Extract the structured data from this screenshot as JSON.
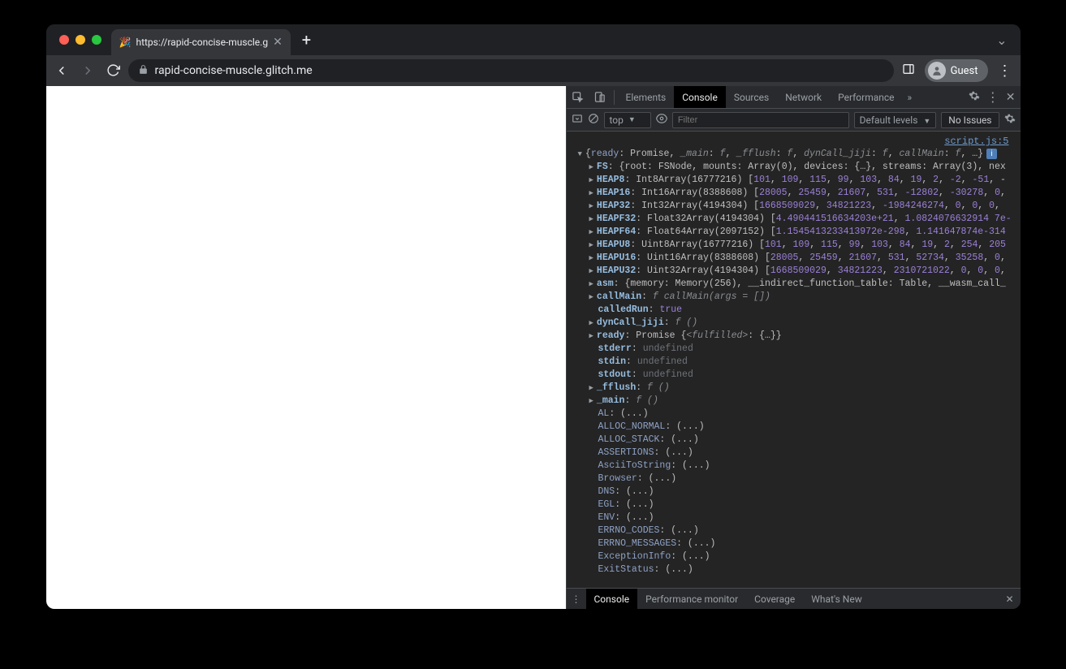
{
  "browser": {
    "tab_title": "https://rapid-concise-muscle.g",
    "tab_favicon": "🎉",
    "url_display": "rapid-concise-muscle.glitch.me",
    "guest_label": "Guest"
  },
  "devtools": {
    "tabs": [
      "Elements",
      "Console",
      "Sources",
      "Network",
      "Performance"
    ],
    "active_tab": "Console",
    "overflow_label": "»",
    "console_toolbar": {
      "context_label": "top",
      "filter_placeholder": "Filter",
      "levels_label": "Default levels",
      "no_issues_label": "No Issues"
    },
    "source_link": "script.js:5",
    "drawer_tabs": [
      "Console",
      "Performance monitor",
      "Coverage",
      "What's New"
    ],
    "active_drawer_tab": "Console"
  },
  "console_output": {
    "summary": {
      "parts": [
        {
          "t": "key",
          "v": "ready"
        },
        {
          "t": "p",
          "v": ": Promise, "
        },
        {
          "t": "ital",
          "v": "_main"
        },
        {
          "t": "p",
          "v": ": "
        },
        {
          "t": "ital",
          "v": "f"
        },
        {
          "t": "p",
          "v": ", "
        },
        {
          "t": "ital",
          "v": "_fflush"
        },
        {
          "t": "p",
          "v": ": "
        },
        {
          "t": "ital",
          "v": "f"
        },
        {
          "t": "p",
          "v": ", "
        },
        {
          "t": "ital",
          "v": "dynCall_jiji"
        },
        {
          "t": "p",
          "v": ": "
        },
        {
          "t": "ital",
          "v": "f"
        },
        {
          "t": "p",
          "v": ", "
        },
        {
          "t": "ital",
          "v": "callMain"
        },
        {
          "t": "p",
          "v": ": "
        },
        {
          "t": "ital",
          "v": "f"
        },
        {
          "t": "p",
          "v": ", …}"
        }
      ]
    },
    "lines": [
      {
        "arrow": true,
        "parts": [
          {
            "t": "keyb",
            "v": "FS"
          },
          {
            "t": "p",
            "v": ": {root: "
          },
          {
            "t": "str",
            "v": "FSNode"
          },
          {
            "t": "p",
            "v": ", mounts: Array(0), devices: {…}, streams: Array(3), nex"
          }
        ]
      },
      {
        "arrow": true,
        "parts": [
          {
            "t": "keyb",
            "v": "HEAP8"
          },
          {
            "t": "p",
            "v": ": Int8Array(16777216) ["
          },
          {
            "t": "num",
            "v": "101"
          },
          {
            "t": "p",
            "v": ", "
          },
          {
            "t": "num",
            "v": "109"
          },
          {
            "t": "p",
            "v": ", "
          },
          {
            "t": "num",
            "v": "115"
          },
          {
            "t": "p",
            "v": ", "
          },
          {
            "t": "num",
            "v": "99"
          },
          {
            "t": "p",
            "v": ", "
          },
          {
            "t": "num",
            "v": "103"
          },
          {
            "t": "p",
            "v": ", "
          },
          {
            "t": "num",
            "v": "84"
          },
          {
            "t": "p",
            "v": ", "
          },
          {
            "t": "num",
            "v": "19"
          },
          {
            "t": "p",
            "v": ", "
          },
          {
            "t": "num",
            "v": "2"
          },
          {
            "t": "p",
            "v": ", "
          },
          {
            "t": "num",
            "v": "-2"
          },
          {
            "t": "p",
            "v": ", "
          },
          {
            "t": "num",
            "v": "-51"
          },
          {
            "t": "p",
            "v": ", -"
          }
        ]
      },
      {
        "arrow": true,
        "parts": [
          {
            "t": "keyb",
            "v": "HEAP16"
          },
          {
            "t": "p",
            "v": ": Int16Array(8388608) ["
          },
          {
            "t": "num",
            "v": "28005"
          },
          {
            "t": "p",
            "v": ", "
          },
          {
            "t": "num",
            "v": "25459"
          },
          {
            "t": "p",
            "v": ", "
          },
          {
            "t": "num",
            "v": "21607"
          },
          {
            "t": "p",
            "v": ", "
          },
          {
            "t": "num",
            "v": "531"
          },
          {
            "t": "p",
            "v": ", "
          },
          {
            "t": "num",
            "v": "-12802"
          },
          {
            "t": "p",
            "v": ", "
          },
          {
            "t": "num",
            "v": "-30278"
          },
          {
            "t": "p",
            "v": ", "
          },
          {
            "t": "num",
            "v": "0"
          },
          {
            "t": "p",
            "v": ","
          }
        ]
      },
      {
        "arrow": true,
        "parts": [
          {
            "t": "keyb",
            "v": "HEAP32"
          },
          {
            "t": "p",
            "v": ": Int32Array(4194304) ["
          },
          {
            "t": "num",
            "v": "1668509029"
          },
          {
            "t": "p",
            "v": ", "
          },
          {
            "t": "num",
            "v": "34821223"
          },
          {
            "t": "p",
            "v": ", "
          },
          {
            "t": "num",
            "v": "-1984246274"
          },
          {
            "t": "p",
            "v": ", "
          },
          {
            "t": "num",
            "v": "0"
          },
          {
            "t": "p",
            "v": ", "
          },
          {
            "t": "num",
            "v": "0"
          },
          {
            "t": "p",
            "v": ", "
          },
          {
            "t": "num",
            "v": "0"
          },
          {
            "t": "p",
            "v": ", "
          }
        ]
      },
      {
        "arrow": true,
        "parts": [
          {
            "t": "keyb",
            "v": "HEAPF32"
          },
          {
            "t": "p",
            "v": ": Float32Array(4194304) ["
          },
          {
            "t": "num",
            "v": "4.490441516634203e+21"
          },
          {
            "t": "p",
            "v": ", "
          },
          {
            "t": "num",
            "v": "1.0824076632914 7e-"
          }
        ]
      },
      {
        "arrow": true,
        "parts": [
          {
            "t": "keyb",
            "v": "HEAPF64"
          },
          {
            "t": "p",
            "v": ": Float64Array(2097152) ["
          },
          {
            "t": "num",
            "v": "1.1545413233413972e-298"
          },
          {
            "t": "p",
            "v": ", "
          },
          {
            "t": "num",
            "v": "1.141647874e-314"
          }
        ]
      },
      {
        "arrow": true,
        "parts": [
          {
            "t": "keyb",
            "v": "HEAPU8"
          },
          {
            "t": "p",
            "v": ": Uint8Array(16777216) ["
          },
          {
            "t": "num",
            "v": "101"
          },
          {
            "t": "p",
            "v": ", "
          },
          {
            "t": "num",
            "v": "109"
          },
          {
            "t": "p",
            "v": ", "
          },
          {
            "t": "num",
            "v": "115"
          },
          {
            "t": "p",
            "v": ", "
          },
          {
            "t": "num",
            "v": "99"
          },
          {
            "t": "p",
            "v": ", "
          },
          {
            "t": "num",
            "v": "103"
          },
          {
            "t": "p",
            "v": ", "
          },
          {
            "t": "num",
            "v": "84"
          },
          {
            "t": "p",
            "v": ", "
          },
          {
            "t": "num",
            "v": "19"
          },
          {
            "t": "p",
            "v": ", "
          },
          {
            "t": "num",
            "v": "2"
          },
          {
            "t": "p",
            "v": ", "
          },
          {
            "t": "num",
            "v": "254"
          },
          {
            "t": "p",
            "v": ", "
          },
          {
            "t": "num",
            "v": "205"
          }
        ]
      },
      {
        "arrow": true,
        "parts": [
          {
            "t": "keyb",
            "v": "HEAPU16"
          },
          {
            "t": "p",
            "v": ": Uint16Array(8388608) ["
          },
          {
            "t": "num",
            "v": "28005"
          },
          {
            "t": "p",
            "v": ", "
          },
          {
            "t": "num",
            "v": "25459"
          },
          {
            "t": "p",
            "v": ", "
          },
          {
            "t": "num",
            "v": "21607"
          },
          {
            "t": "p",
            "v": ", "
          },
          {
            "t": "num",
            "v": "531"
          },
          {
            "t": "p",
            "v": ", "
          },
          {
            "t": "num",
            "v": "52734"
          },
          {
            "t": "p",
            "v": ", "
          },
          {
            "t": "num",
            "v": "35258"
          },
          {
            "t": "p",
            "v": ", "
          },
          {
            "t": "num",
            "v": "0"
          },
          {
            "t": "p",
            "v": ","
          }
        ]
      },
      {
        "arrow": true,
        "parts": [
          {
            "t": "keyb",
            "v": "HEAPU32"
          },
          {
            "t": "p",
            "v": ": Uint32Array(4194304) ["
          },
          {
            "t": "num",
            "v": "1668509029"
          },
          {
            "t": "p",
            "v": ", "
          },
          {
            "t": "num",
            "v": "34821223"
          },
          {
            "t": "p",
            "v": ", "
          },
          {
            "t": "num",
            "v": "2310721022"
          },
          {
            "t": "p",
            "v": ", "
          },
          {
            "t": "num",
            "v": "0"
          },
          {
            "t": "p",
            "v": ", "
          },
          {
            "t": "num",
            "v": "0"
          },
          {
            "t": "p",
            "v": ", "
          },
          {
            "t": "num",
            "v": "0"
          },
          {
            "t": "p",
            "v": ","
          }
        ]
      },
      {
        "arrow": true,
        "parts": [
          {
            "t": "keyb",
            "v": "asm"
          },
          {
            "t": "p",
            "v": ": {memory: Memory(256), __indirect_function_table: Table, __wasm_call_"
          }
        ]
      },
      {
        "arrow": true,
        "parts": [
          {
            "t": "keyb",
            "v": "callMain"
          },
          {
            "t": "p",
            "v": ": "
          },
          {
            "t": "ital",
            "v": "f callMain(args = [])"
          }
        ]
      },
      {
        "arrow": false,
        "parts": [
          {
            "t": "keyb",
            "v": "calledRun"
          },
          {
            "t": "p",
            "v": ": "
          },
          {
            "t": "bool",
            "v": "true"
          }
        ]
      },
      {
        "arrow": true,
        "parts": [
          {
            "t": "keyb",
            "v": "dynCall_jiji"
          },
          {
            "t": "p",
            "v": ": "
          },
          {
            "t": "ital",
            "v": "f ()"
          }
        ]
      },
      {
        "arrow": true,
        "parts": [
          {
            "t": "keyb",
            "v": "ready"
          },
          {
            "t": "p",
            "v": ": Promise {"
          },
          {
            "t": "ital",
            "v": "<fulfilled>"
          },
          {
            "t": "p",
            "v": ": {…}}"
          }
        ]
      },
      {
        "arrow": false,
        "parts": [
          {
            "t": "keyb",
            "v": "stderr"
          },
          {
            "t": "p",
            "v": ": "
          },
          {
            "t": "undef",
            "v": "undefined"
          }
        ]
      },
      {
        "arrow": false,
        "parts": [
          {
            "t": "keyb",
            "v": "stdin"
          },
          {
            "t": "p",
            "v": ": "
          },
          {
            "t": "undef",
            "v": "undefined"
          }
        ]
      },
      {
        "arrow": false,
        "parts": [
          {
            "t": "keyb",
            "v": "stdout"
          },
          {
            "t": "p",
            "v": ": "
          },
          {
            "t": "undef",
            "v": "undefined"
          }
        ]
      },
      {
        "arrow": true,
        "parts": [
          {
            "t": "keyb",
            "v": "_fflush"
          },
          {
            "t": "p",
            "v": ": "
          },
          {
            "t": "ital",
            "v": "f ()"
          }
        ]
      },
      {
        "arrow": true,
        "parts": [
          {
            "t": "keyb",
            "v": "_main"
          },
          {
            "t": "p",
            "v": ": "
          },
          {
            "t": "ital",
            "v": "f ()"
          }
        ]
      },
      {
        "arrow": false,
        "parts": [
          {
            "t": "key",
            "v": "AL"
          },
          {
            "t": "p",
            "v": ": (...)"
          }
        ]
      },
      {
        "arrow": false,
        "parts": [
          {
            "t": "key",
            "v": "ALLOC_NORMAL"
          },
          {
            "t": "p",
            "v": ": (...)"
          }
        ]
      },
      {
        "arrow": false,
        "parts": [
          {
            "t": "key",
            "v": "ALLOC_STACK"
          },
          {
            "t": "p",
            "v": ": (...)"
          }
        ]
      },
      {
        "arrow": false,
        "parts": [
          {
            "t": "key",
            "v": "ASSERTIONS"
          },
          {
            "t": "p",
            "v": ": (...)"
          }
        ]
      },
      {
        "arrow": false,
        "parts": [
          {
            "t": "key",
            "v": "AsciiToString"
          },
          {
            "t": "p",
            "v": ": (...)"
          }
        ]
      },
      {
        "arrow": false,
        "parts": [
          {
            "t": "key",
            "v": "Browser"
          },
          {
            "t": "p",
            "v": ": (...)"
          }
        ]
      },
      {
        "arrow": false,
        "parts": [
          {
            "t": "key",
            "v": "DNS"
          },
          {
            "t": "p",
            "v": ": (...)"
          }
        ]
      },
      {
        "arrow": false,
        "parts": [
          {
            "t": "key",
            "v": "EGL"
          },
          {
            "t": "p",
            "v": ": (...)"
          }
        ]
      },
      {
        "arrow": false,
        "parts": [
          {
            "t": "key",
            "v": "ENV"
          },
          {
            "t": "p",
            "v": ": (...)"
          }
        ]
      },
      {
        "arrow": false,
        "parts": [
          {
            "t": "key",
            "v": "ERRNO_CODES"
          },
          {
            "t": "p",
            "v": ": (...)"
          }
        ]
      },
      {
        "arrow": false,
        "parts": [
          {
            "t": "key",
            "v": "ERRNO_MESSAGES"
          },
          {
            "t": "p",
            "v": ": (...)"
          }
        ]
      },
      {
        "arrow": false,
        "parts": [
          {
            "t": "key",
            "v": "ExceptionInfo"
          },
          {
            "t": "p",
            "v": ": (...)"
          }
        ]
      },
      {
        "arrow": false,
        "parts": [
          {
            "t": "key",
            "v": "ExitStatus"
          },
          {
            "t": "p",
            "v": ": (...)"
          }
        ]
      }
    ]
  }
}
